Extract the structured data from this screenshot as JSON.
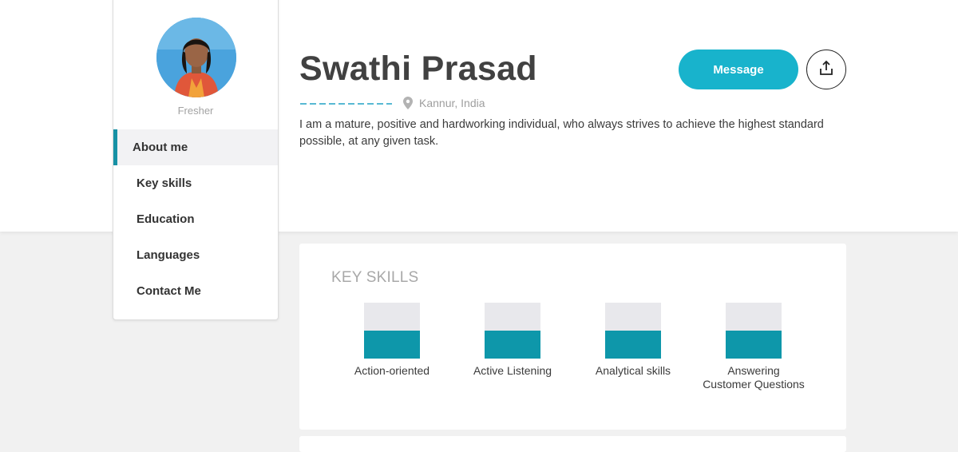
{
  "profile": {
    "name": "Swathi Prasad",
    "level": "Fresher",
    "location": "Kannur, India",
    "bio": "I am a mature, positive and hardworking individual, who always strives to achieve the highest standard possible, at any given task."
  },
  "nav": {
    "items": [
      {
        "label": "About me",
        "active": true
      },
      {
        "label": "Key skills",
        "active": false
      },
      {
        "label": "Education",
        "active": false
      },
      {
        "label": "Languages",
        "active": false
      },
      {
        "label": "Contact Me",
        "active": false
      }
    ]
  },
  "actions": {
    "message_label": "Message",
    "share_icon": "share-upload-icon"
  },
  "skills_card": {
    "title": "KEY SKILLS",
    "skills": [
      {
        "label": "Action-oriented",
        "level": 0.5
      },
      {
        "label": "Active Listening",
        "level": 0.5
      },
      {
        "label": "Analytical skills",
        "level": 0.5
      },
      {
        "label": "Answering Customer Questions",
        "level": 0.5
      }
    ]
  },
  "colors": {
    "accent": "#18b3cc",
    "skill_fill": "#0e97aa",
    "active_nav_border": "#1791a5"
  }
}
